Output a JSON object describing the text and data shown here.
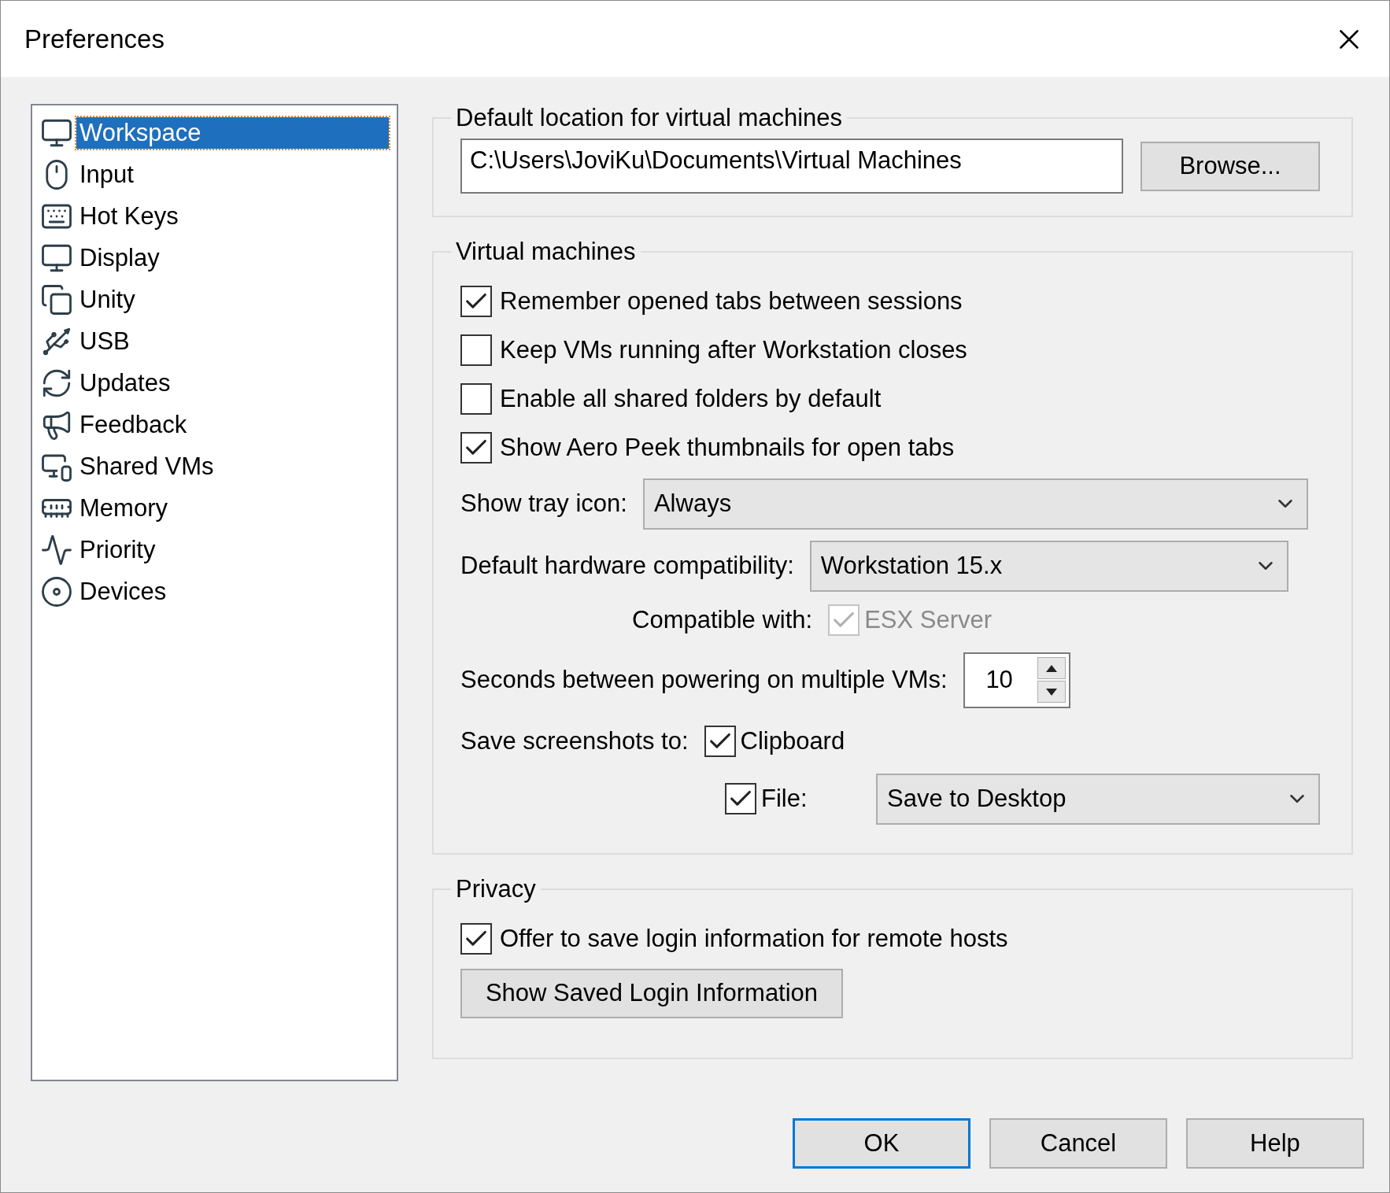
{
  "window": {
    "title": "Preferences"
  },
  "sidebar": {
    "items": [
      {
        "label": "Workspace",
        "selected": true
      },
      {
        "label": "Input",
        "selected": false
      },
      {
        "label": "Hot Keys",
        "selected": false
      },
      {
        "label": "Display",
        "selected": false
      },
      {
        "label": "Unity",
        "selected": false
      },
      {
        "label": "USB",
        "selected": false
      },
      {
        "label": "Updates",
        "selected": false
      },
      {
        "label": "Feedback",
        "selected": false
      },
      {
        "label": "Shared VMs",
        "selected": false
      },
      {
        "label": "Memory",
        "selected": false
      },
      {
        "label": "Priority",
        "selected": false
      },
      {
        "label": "Devices",
        "selected": false
      }
    ]
  },
  "location": {
    "legend": "Default location for virtual machines",
    "value": "C:\\Users\\JoviKu\\Documents\\Virtual Machines",
    "browse": "Browse..."
  },
  "virtual_machines": {
    "legend": "Virtual machines",
    "checkboxes": [
      {
        "label": "Remember opened tabs between sessions",
        "checked": true
      },
      {
        "label": "Keep VMs running after Workstation closes",
        "checked": false
      },
      {
        "label": "Enable all shared folders by default",
        "checked": false
      },
      {
        "label": "Show Aero Peek thumbnails for open tabs",
        "checked": true
      }
    ],
    "tray": {
      "label": "Show tray icon:",
      "value": "Always"
    },
    "hardware": {
      "label": "Default hardware compatibility:",
      "value": "Workstation 15.x"
    },
    "compatible": {
      "label": "Compatible with:",
      "option": "ESX Server",
      "checked": true,
      "disabled": true
    },
    "seconds": {
      "label": "Seconds between powering on multiple VMs:",
      "value": "10"
    },
    "screenshots": {
      "label": "Save screenshots to:",
      "clipboard": {
        "label": "Clipboard",
        "checked": true
      },
      "file": {
        "label": "File:",
        "checked": true,
        "value": "Save to Desktop"
      }
    }
  },
  "privacy": {
    "legend": "Privacy",
    "checkbox": {
      "label": "Offer to save login information for remote hosts",
      "checked": true
    },
    "button": "Show Saved Login Information"
  },
  "buttons": [
    {
      "label": "OK",
      "default": true
    },
    {
      "label": "Cancel",
      "default": false
    },
    {
      "label": "Help",
      "default": false
    }
  ]
}
